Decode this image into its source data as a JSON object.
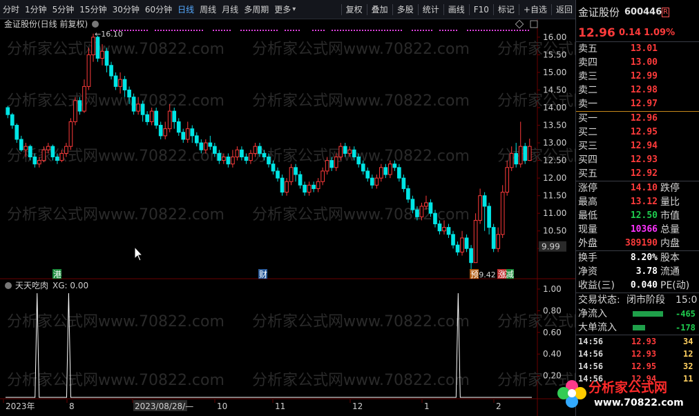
{
  "toolbar": {
    "periods": [
      "分时",
      "1分钟",
      "5分钟",
      "15分钟",
      "30分钟",
      "60分钟",
      "日线",
      "周线",
      "月线",
      "多周期",
      "更多"
    ],
    "active_period": "日线",
    "tools": [
      "复权",
      "叠加",
      "多股",
      "统计",
      "画线",
      "F10",
      "标记",
      "+自选",
      "返回"
    ]
  },
  "chart": {
    "title": "金证股份(日线 前复权)",
    "high_label": "16.10",
    "low_label": "9.42",
    "price_ticks": [
      "16.00",
      "15.50",
      "15.00",
      "14.50",
      "14.00",
      "13.50",
      "13.00",
      "12.50",
      "12.00",
      "11.50",
      "11.00",
      "10.50",
      "10.00"
    ],
    "current_price_tag": "9.99",
    "markers": [
      {
        "text": "港",
        "color": "#1a8a3a"
      },
      {
        "text": "财",
        "color": "#2a5a9a"
      },
      {
        "text": "预",
        "color": "#b05a10"
      },
      {
        "text": "减",
        "color": "#1a8a3a"
      },
      {
        "text": "涨",
        "color": "#c03030"
      }
    ],
    "watermark": "分析家公式网www.70822.com"
  },
  "indicator": {
    "name": "天天吃肉",
    "label": "XG: 0.00",
    "ticks": [
      "1.00",
      "0.80",
      "0.60",
      "0.40",
      "0.20"
    ]
  },
  "date_axis": {
    "labels": [
      "2023年",
      "8",
      "2023/08/28/—",
      "10",
      "11",
      "12",
      "1",
      "2"
    ]
  },
  "quote": {
    "name": "金证股份",
    "code": "600446",
    "badge": "R",
    "price": "12.96",
    "change": "0.14",
    "change_pct": "1.09%",
    "asks": [
      {
        "label": "卖五",
        "price": "13.01"
      },
      {
        "label": "卖四",
        "price": "13.00"
      },
      {
        "label": "卖三",
        "price": "12.99"
      },
      {
        "label": "卖二",
        "price": "12.98"
      },
      {
        "label": "卖一",
        "price": "12.97"
      }
    ],
    "bids": [
      {
        "label": "买一",
        "price": "12.96"
      },
      {
        "label": "买二",
        "price": "12.95"
      },
      {
        "label": "买三",
        "price": "12.94"
      },
      {
        "label": "买四",
        "price": "12.93"
      },
      {
        "label": "买五",
        "price": "12.92"
      }
    ],
    "stats": [
      {
        "label": "涨停",
        "value": "14.10",
        "color": "red",
        "label2": "跌停"
      },
      {
        "label": "最高",
        "value": "13.12",
        "color": "red",
        "label2": "量比"
      },
      {
        "label": "最低",
        "value": "12.50",
        "color": "green",
        "label2": "市值"
      },
      {
        "label": "现量",
        "value": "10366",
        "color": "magenta",
        "label2": "总量"
      },
      {
        "label": "外盘",
        "value": "389190",
        "color": "red",
        "label2": "内盘"
      }
    ],
    "stats2": [
      {
        "label": "换手",
        "value": "8.20%",
        "label2": "股本"
      },
      {
        "label": "净资",
        "value": "3.78",
        "label2": "流通"
      },
      {
        "label": "收益(三)",
        "value": "0.040",
        "label2": "PE(动)"
      }
    ],
    "trade_status_label": "交易状态:",
    "trade_status": "闭市阶段",
    "trade_time": "15:0",
    "flows": [
      {
        "label": "净流入",
        "value": "-465"
      },
      {
        "label": "大单流入",
        "value": "-178"
      }
    ],
    "ticks": [
      {
        "time": "14:56",
        "price": "12.93",
        "vol": "34"
      },
      {
        "time": "14:56",
        "price": "12.93",
        "vol": "12"
      },
      {
        "time": "14:56",
        "price": "12.95",
        "vol": "32"
      },
      {
        "time": "14:56",
        "price": "12.94",
        "vol": "11"
      }
    ]
  },
  "logo": {
    "name": "分析家公式网",
    "url": "www.70822.com"
  },
  "candles": [
    [
      14.0,
      13.8,
      14.05,
      13.7
    ],
    [
      13.8,
      13.5,
      13.85,
      13.4
    ],
    [
      13.5,
      13.1,
      13.55,
      13.0
    ],
    [
      13.1,
      12.8,
      13.2,
      12.75
    ],
    [
      12.8,
      12.9,
      13.0,
      12.6
    ],
    [
      12.9,
      12.6,
      12.95,
      12.5
    ],
    [
      12.6,
      12.4,
      12.7,
      12.3
    ],
    [
      12.4,
      12.5,
      12.6,
      12.3
    ],
    [
      12.5,
      12.8,
      12.9,
      12.45
    ],
    [
      12.8,
      12.9,
      13.0,
      12.7
    ],
    [
      12.9,
      12.6,
      12.95,
      12.5
    ],
    [
      12.6,
      12.5,
      12.7,
      12.4
    ],
    [
      12.5,
      12.7,
      12.8,
      12.45
    ],
    [
      12.7,
      12.9,
      13.0,
      12.6
    ],
    [
      12.9,
      13.6,
      13.7,
      12.8
    ],
    [
      13.6,
      14.2,
      14.3,
      13.5
    ],
    [
      14.2,
      13.9,
      14.3,
      13.8
    ],
    [
      13.9,
      14.6,
      14.8,
      13.85
    ],
    [
      14.6,
      15.5,
      15.7,
      14.5
    ],
    [
      15.5,
      16.0,
      16.1,
      15.3
    ],
    [
      16.0,
      15.4,
      16.05,
      15.3
    ],
    [
      15.4,
      15.6,
      15.8,
      15.2
    ],
    [
      15.6,
      15.2,
      15.7,
      15.0
    ],
    [
      15.2,
      14.9,
      15.3,
      14.8
    ],
    [
      14.9,
      14.6,
      15.0,
      14.5
    ],
    [
      14.6,
      14.8,
      15.0,
      14.4
    ],
    [
      14.8,
      14.5,
      14.9,
      14.3
    ],
    [
      14.5,
      14.3,
      14.6,
      14.1
    ],
    [
      14.3,
      13.9,
      14.4,
      13.8
    ],
    [
      13.9,
      14.1,
      14.3,
      13.8
    ],
    [
      14.1,
      13.8,
      14.2,
      13.6
    ],
    [
      13.8,
      13.6,
      13.9,
      13.5
    ],
    [
      13.6,
      13.9,
      14.0,
      13.5
    ],
    [
      13.9,
      13.5,
      14.0,
      13.4
    ],
    [
      13.5,
      13.2,
      13.6,
      13.1
    ],
    [
      13.2,
      13.4,
      13.6,
      13.1
    ],
    [
      13.4,
      13.9,
      14.1,
      13.3
    ],
    [
      13.9,
      13.6,
      14.0,
      13.4
    ],
    [
      13.6,
      13.3,
      13.7,
      13.2
    ],
    [
      13.3,
      13.1,
      13.4,
      13.0
    ],
    [
      13.1,
      13.4,
      13.6,
      13.0
    ],
    [
      13.4,
      13.2,
      13.5,
      13.0
    ],
    [
      13.2,
      13.0,
      13.3,
      12.9
    ],
    [
      13.0,
      12.8,
      13.1,
      12.7
    ],
    [
      12.8,
      13.0,
      13.1,
      12.7
    ],
    [
      13.0,
      12.9,
      13.2,
      12.8
    ],
    [
      12.9,
      12.7,
      13.0,
      12.6
    ],
    [
      12.7,
      12.5,
      12.8,
      12.4
    ],
    [
      12.5,
      12.6,
      12.7,
      12.4
    ],
    [
      12.6,
      12.4,
      12.7,
      12.3
    ],
    [
      12.4,
      12.6,
      12.8,
      12.3
    ],
    [
      12.6,
      12.8,
      12.9,
      12.5
    ],
    [
      12.8,
      12.6,
      12.9,
      12.5
    ],
    [
      12.6,
      12.5,
      12.7,
      12.4
    ],
    [
      12.5,
      12.7,
      12.8,
      12.4
    ],
    [
      12.7,
      12.9,
      13.0,
      12.6
    ],
    [
      12.9,
      12.7,
      13.0,
      12.6
    ],
    [
      12.7,
      12.6,
      12.8,
      12.5
    ],
    [
      12.6,
      12.4,
      12.7,
      12.3
    ],
    [
      12.4,
      12.2,
      12.5,
      12.1
    ],
    [
      12.2,
      12.0,
      12.3,
      11.9
    ],
    [
      12.0,
      11.6,
      12.1,
      11.5
    ],
    [
      11.6,
      11.9,
      12.0,
      11.5
    ],
    [
      11.9,
      12.3,
      12.4,
      11.8
    ],
    [
      12.3,
      12.1,
      12.4,
      11.9
    ],
    [
      12.1,
      11.8,
      12.2,
      11.7
    ],
    [
      11.8,
      11.6,
      11.9,
      11.5
    ],
    [
      11.6,
      11.8,
      11.9,
      11.5
    ],
    [
      11.8,
      11.7,
      11.9,
      11.6
    ],
    [
      11.7,
      11.9,
      12.0,
      11.6
    ],
    [
      11.9,
      12.2,
      12.3,
      11.8
    ],
    [
      12.2,
      12.5,
      12.6,
      12.1
    ],
    [
      12.5,
      12.3,
      12.6,
      12.2
    ],
    [
      12.3,
      12.6,
      12.7,
      12.2
    ],
    [
      12.6,
      12.9,
      13.0,
      12.5
    ],
    [
      12.9,
      12.7,
      13.0,
      12.6
    ],
    [
      12.7,
      12.8,
      12.9,
      12.6
    ],
    [
      12.8,
      12.6,
      12.9,
      12.5
    ],
    [
      12.6,
      12.4,
      12.7,
      12.3
    ],
    [
      12.4,
      12.2,
      12.5,
      12.1
    ],
    [
      12.2,
      12.0,
      12.3,
      11.9
    ],
    [
      12.0,
      11.8,
      12.1,
      11.7
    ],
    [
      11.8,
      12.0,
      12.1,
      11.7
    ],
    [
      12.0,
      12.3,
      12.4,
      11.9
    ],
    [
      12.3,
      12.1,
      12.4,
      12.0
    ],
    [
      12.1,
      12.4,
      12.5,
      12.0
    ],
    [
      12.4,
      12.3,
      12.5,
      12.2
    ],
    [
      12.3,
      12.0,
      12.4,
      11.9
    ],
    [
      12.0,
      11.7,
      12.1,
      11.6
    ],
    [
      11.7,
      11.4,
      11.8,
      11.3
    ],
    [
      11.4,
      11.1,
      11.5,
      11.0
    ],
    [
      11.1,
      10.9,
      11.2,
      10.8
    ],
    [
      10.9,
      11.2,
      11.3,
      10.8
    ],
    [
      11.2,
      11.3,
      11.5,
      11.1
    ],
    [
      11.3,
      11.0,
      11.4,
      10.9
    ],
    [
      11.0,
      10.7,
      11.1,
      10.6
    ],
    [
      10.7,
      10.5,
      10.8,
      10.4
    ],
    [
      10.5,
      10.6,
      10.8,
      10.4
    ],
    [
      10.6,
      10.4,
      10.7,
      10.3
    ],
    [
      10.4,
      10.1,
      10.5,
      10.0
    ],
    [
      10.1,
      9.9,
      10.2,
      9.8
    ],
    [
      9.9,
      10.3,
      10.5,
      9.8
    ],
    [
      10.3,
      10.0,
      10.4,
      9.9
    ],
    [
      10.0,
      9.6,
      10.1,
      9.42
    ],
    [
      9.6,
      10.8,
      11.0,
      9.6
    ],
    [
      10.8,
      11.5,
      11.7,
      10.7
    ],
    [
      11.5,
      11.2,
      11.6,
      10.5
    ],
    [
      11.2,
      10.6,
      11.3,
      10.4
    ],
    [
      10.6,
      10.0,
      10.7,
      9.9
    ],
    [
      10.0,
      10.4,
      10.6,
      9.9
    ],
    [
      10.4,
      11.6,
      11.8,
      10.3
    ],
    [
      11.6,
      12.3,
      12.5,
      11.5
    ],
    [
      12.3,
      12.7,
      12.9,
      12.2
    ],
    [
      12.7,
      12.4,
      13.0,
      12.3
    ],
    [
      12.4,
      12.9,
      13.6,
      12.3
    ],
    [
      12.9,
      12.5,
      13.0,
      12.4
    ],
    [
      12.5,
      12.9,
      13.12,
      12.5
    ]
  ],
  "signals": [
    0.06,
    0.12,
    0.86
  ]
}
